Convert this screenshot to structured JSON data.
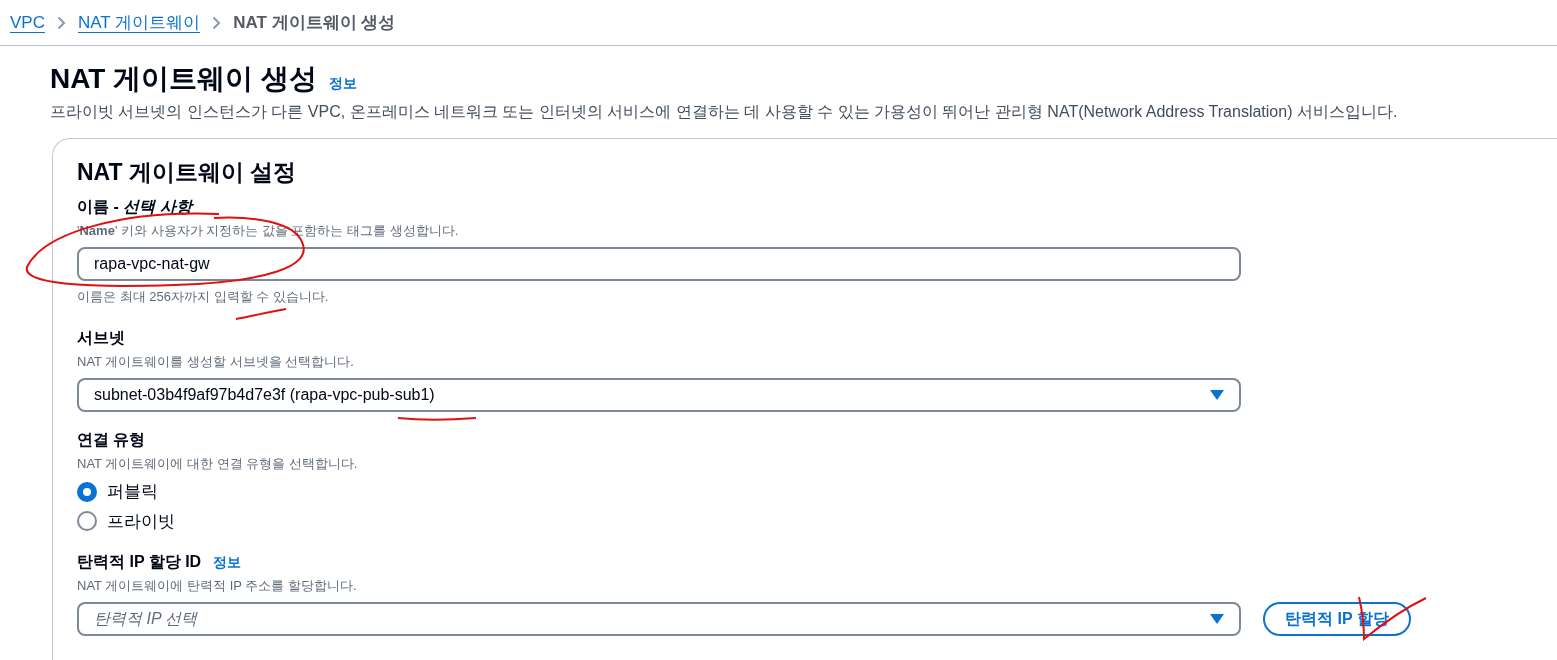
{
  "breadcrumb": [
    {
      "label": "VPC",
      "kind": "link"
    },
    {
      "label": "NAT 게이트웨이",
      "kind": "link"
    },
    {
      "label": "NAT 게이트웨이 생성",
      "kind": "current"
    }
  ],
  "page": {
    "title": "NAT 게이트웨이 생성",
    "info": "정보",
    "description": "프라이빗 서브넷의 인스턴스가 다른 VPC, 온프레미스 네트워크 또는 인터넷의 서비스에 연결하는 데 사용할 수 있는 가용성이 뛰어난 관리형 NAT(Network Address Translation) 서비스입니다."
  },
  "panel": {
    "title": "NAT 게이트웨이 설정",
    "name_field": {
      "label": "이름 - ",
      "label_optional": "선택 사항",
      "hint": "'**Name**' 키와 사용자가 지정하는 값을 포함하는 태그를 생성합니다.",
      "value": "rapa-vpc-nat-gw",
      "constraint": "이름은 최대 256자까지 입력할 수 있습니다."
    },
    "subnet_field": {
      "label": "서브넷",
      "hint": "NAT 게이트웨이를 생성할 서브넷을 선택합니다.",
      "value": "subnet-03b4f9af97b4d7e3f (rapa-vpc-pub-sub1)"
    },
    "connectivity_field": {
      "label": "연결 유형",
      "hint": "NAT 게이트웨이에 대한 연결 유형을 선택합니다.",
      "options": [
        {
          "label": "퍼블릭",
          "selected": true
        },
        {
          "label": "프라이빗",
          "selected": false
        }
      ]
    },
    "eip_field": {
      "label": "탄력적 IP 할당 ID",
      "info": "정보",
      "hint": "NAT 게이트웨이에 탄력적 IP 주소를 할당합니다.",
      "placeholder": "탄력적 IP 선택",
      "button": "탄력적 IP 할당"
    }
  }
}
